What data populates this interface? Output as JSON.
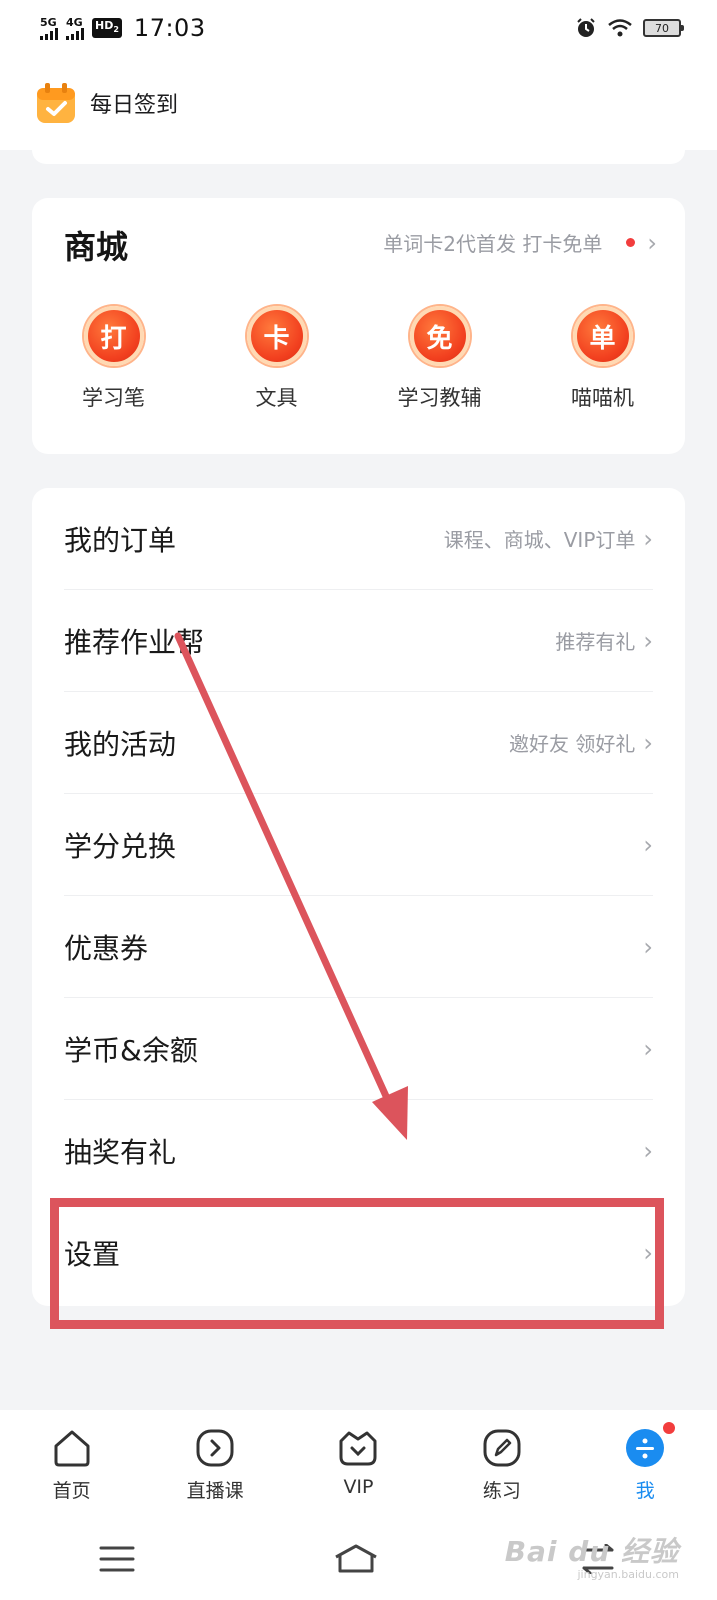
{
  "status_bar": {
    "network_1": "5G",
    "network_2": "4G",
    "hd_badge": "HD",
    "hd_sub": "2",
    "time": "17:03",
    "battery": "70"
  },
  "signin": {
    "label": "每日签到",
    "icon": "calendar-check-icon"
  },
  "mall": {
    "title": "商城",
    "promo": "单词卡2代首发 打卡免单",
    "items": [
      {
        "glyph": "打",
        "label": "学习笔"
      },
      {
        "glyph": "卡",
        "label": "文具"
      },
      {
        "glyph": "免",
        "label": "学习教辅"
      },
      {
        "glyph": "单",
        "label": "喵喵机"
      }
    ]
  },
  "menu": {
    "items": [
      {
        "label": "我的订单",
        "sub": "课程、商城、VIP订单"
      },
      {
        "label": "推荐作业帮",
        "sub": "推荐有礼"
      },
      {
        "label": "我的活动",
        "sub": "邀好友 领好礼"
      },
      {
        "label": "学分兑换",
        "sub": ""
      },
      {
        "label": "优惠券",
        "sub": ""
      },
      {
        "label": "学币&余额",
        "sub": ""
      },
      {
        "label": "抽奖有礼",
        "sub": ""
      },
      {
        "label": "设置",
        "sub": ""
      }
    ],
    "chevron": "›"
  },
  "tabs": [
    {
      "label": "首页",
      "icon": "home-icon",
      "active": false
    },
    {
      "label": "直播课",
      "icon": "play-circle-icon",
      "active": false
    },
    {
      "label": "VIP",
      "icon": "vip-crown-icon",
      "active": false
    },
    {
      "label": "练习",
      "icon": "pen-icon",
      "active": false
    },
    {
      "label": "我",
      "icon": "profile-icon",
      "active": true
    }
  ],
  "watermark": {
    "main": "Bai du 经验",
    "sub": "jingyan.baidu.com"
  },
  "colors": {
    "accent_blue": "#1a8cf0",
    "annotation_red": "#dc545c",
    "badge_red": "#f23d3d"
  }
}
